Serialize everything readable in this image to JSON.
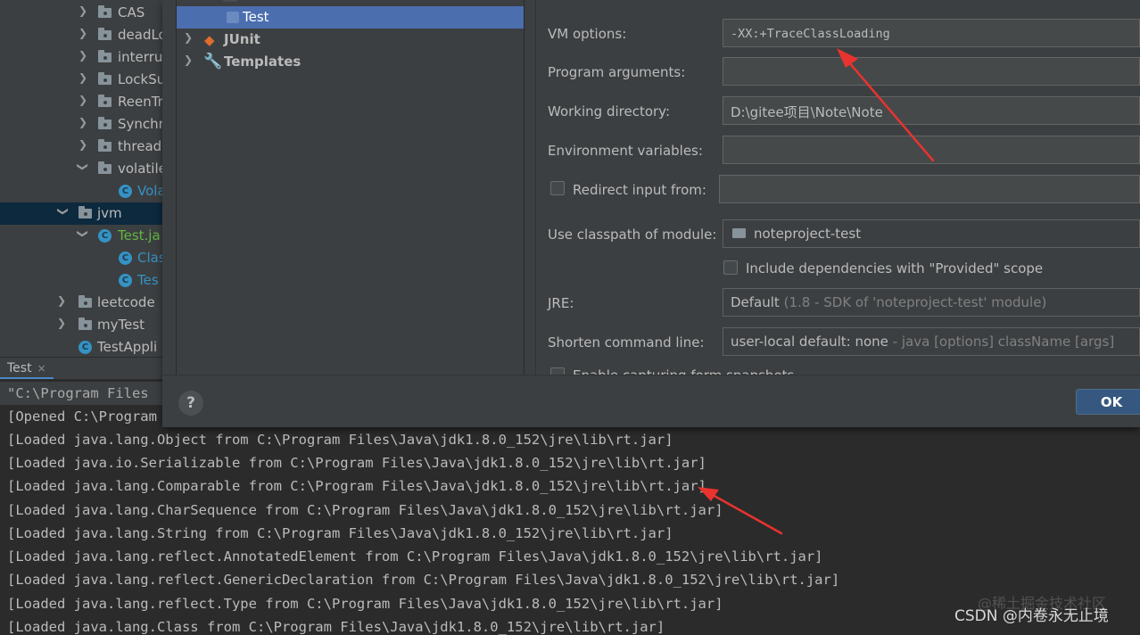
{
  "tree": {
    "items": [
      {
        "label": "CAS",
        "kind": "folder",
        "expanded": false
      },
      {
        "label": "deadLo",
        "kind": "folder",
        "expanded": false
      },
      {
        "label": "interru",
        "kind": "folder",
        "expanded": false
      },
      {
        "label": "LockSu",
        "kind": "folder",
        "expanded": false
      },
      {
        "label": "ReenTr",
        "kind": "folder",
        "expanded": false
      },
      {
        "label": "Synchr",
        "kind": "folder",
        "expanded": false
      },
      {
        "label": "thread",
        "kind": "folder",
        "expanded": false
      },
      {
        "label": "volatile",
        "kind": "folder",
        "expanded": true
      },
      {
        "label": "Vola",
        "kind": "class"
      },
      {
        "label": "jvm",
        "kind": "folder",
        "expanded": true,
        "selected": true
      },
      {
        "label": "Test.ja",
        "kind": "java-file",
        "expanded": true
      },
      {
        "label": "Clas",
        "kind": "class"
      },
      {
        "label": "Tes",
        "kind": "class"
      },
      {
        "label": "leetcode",
        "kind": "folder",
        "expanded": false
      },
      {
        "label": "myTest",
        "kind": "folder",
        "expanded": false
      },
      {
        "label": "TestAppli",
        "kind": "class"
      }
    ]
  },
  "console": {
    "tab_label": "Test",
    "tab_close": "×",
    "lines": [
      "\"C:\\Program Files",
      "[Opened C:\\Program",
      "[Loaded java.lang.Object from C:\\Program Files\\Java\\jdk1.8.0_152\\jre\\lib\\rt.jar]",
      "[Loaded java.io.Serializable from C:\\Program Files\\Java\\jdk1.8.0_152\\jre\\lib\\rt.jar]",
      "[Loaded java.lang.Comparable from C:\\Program Files\\Java\\jdk1.8.0_152\\jre\\lib\\rt.jar]",
      "[Loaded java.lang.CharSequence from C:\\Program Files\\Java\\jdk1.8.0_152\\jre\\lib\\rt.jar]",
      "[Loaded java.lang.String from C:\\Program Files\\Java\\jdk1.8.0_152\\jre\\lib\\rt.jar]",
      "[Loaded java.lang.reflect.AnnotatedElement from C:\\Program Files\\Java\\jdk1.8.0_152\\jre\\lib\\rt.jar]",
      "[Loaded java.lang.reflect.GenericDeclaration from C:\\Program Files\\Java\\jdk1.8.0_152\\jre\\lib\\rt.jar]",
      "[Loaded java.lang.reflect.Type from C:\\Program Files\\Java\\jdk1.8.0_152\\jre\\lib\\rt.jar]",
      "[Loaded java.lang.Class from C:\\Program Files\\Java\\jdk1.8.0_152\\jre\\lib\\rt.jar]"
    ]
  },
  "config_list": {
    "items": [
      {
        "label": "Test",
        "selected": true
      },
      {
        "label": "JUnit",
        "bold": true
      },
      {
        "label": "Templates",
        "bold": true
      }
    ]
  },
  "form": {
    "vm_options_label": "VM options:",
    "vm_options_value": "-XX:+TraceClassLoading",
    "program_args_label": "Program arguments:",
    "program_args_value": "",
    "working_dir_label": "Working directory:",
    "working_dir_value": "D:\\gitee项目\\Note\\Note",
    "env_vars_label": "Environment variables:",
    "env_vars_value": "",
    "redirect_label": "Redirect input from:",
    "redirect_value": "",
    "classpath_label": "Use classpath of module:",
    "classpath_value": "noteproject-test",
    "include_deps_label": "Include dependencies with \"Provided\" scope",
    "jre_label": "JRE:",
    "jre_value": "Default",
    "jre_hint": "(1.8 - SDK of 'noteproject-test' module)",
    "shorten_label": "Shorten command line:",
    "shorten_value": "user-local default: none",
    "shorten_hint": "- java [options] className [args]",
    "snapshots_label": "Enable capturing form snapshots"
  },
  "footer": {
    "help_label": "?",
    "ok_label": "OK"
  },
  "watermark": {
    "text": "CSDN @内卷永无止境",
    "faint_text": "@稀土掘金技术社区"
  },
  "colors": {
    "accent": "#4b6eaf",
    "annotation_arrow": "#e8332f"
  }
}
